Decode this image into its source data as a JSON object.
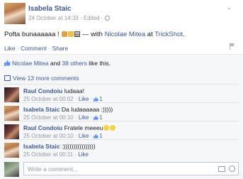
{
  "post": {
    "author": "Isabela Staic",
    "meta": "24 October at 14:33 · Edited ·",
    "text_before": "Pofta bunaaaaaa ! ",
    "text_with": " — with ",
    "tagged": "Nicolae Mitea",
    "at": " at ",
    "place": "TrickShot",
    "period": "."
  },
  "actions": {
    "like": "Like",
    "sep1": " · ",
    "comment": "Comment",
    "sep2": " · ",
    "share": "Share"
  },
  "likes": {
    "person": "Nicolae Mitea",
    "and": " and ",
    "others": "38 others",
    "tail": " like this."
  },
  "view_more": "View 13 more comments",
  "comments": [
    {
      "author": "Raul Condoiu",
      "text": " Iudaaa!",
      "time": "25 October at 00:02",
      "like": "Like",
      "likes": "1"
    },
    {
      "author": "Isabela Staic",
      "text": " Da Iudaaaaaa :)))))",
      "time": "25 October at 00:10",
      "like": "Like",
      "likes": "1"
    },
    {
      "author": "Raul Condoiu",
      "text": " Fratele meeeu",
      "time": "25 October at 00:10",
      "like": "Like",
      "likes": "1"
    },
    {
      "author": "Isabela Staic",
      "text": " :))))))))))))))))",
      "time": "25 October at 00:11",
      "like": "Like",
      "likes": ""
    }
  ],
  "write_placeholder": "Write a comment...",
  "colors": {
    "link": "#3b5998",
    "muted": "#9197a3",
    "panel": "#f6f7f8"
  }
}
